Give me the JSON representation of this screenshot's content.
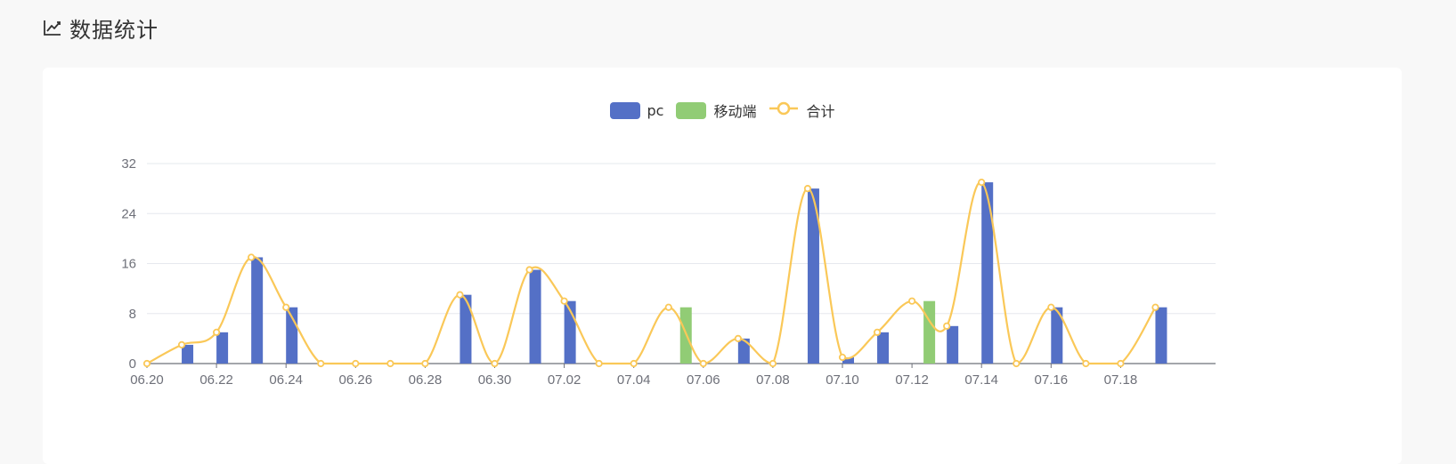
{
  "page": {
    "title": "数据统计",
    "title_icon": "line-chart-icon"
  },
  "colors": {
    "pc": "#5470c6",
    "mobile": "#91cc75",
    "total": "#fac858"
  },
  "chart_data": {
    "type": "bar",
    "categories": [
      "06.20",
      "06.21",
      "06.22",
      "06.23",
      "06.24",
      "06.25",
      "06.26",
      "06.27",
      "06.28",
      "06.29",
      "06.30",
      "07.01",
      "07.02",
      "07.03",
      "07.04",
      "07.05",
      "07.06",
      "07.07",
      "07.08",
      "07.09",
      "07.10",
      "07.11",
      "07.12",
      "07.13",
      "07.14",
      "07.15",
      "07.16",
      "07.17",
      "07.18",
      "07.19"
    ],
    "x_tick_labels": [
      "06.20",
      "06.22",
      "06.24",
      "06.26",
      "06.28",
      "06.30",
      "07.02",
      "07.04",
      "07.06",
      "07.08",
      "07.10",
      "07.12",
      "07.14",
      "07.16",
      "07.18"
    ],
    "y_tick_labels": [
      "0",
      "8",
      "16",
      "24",
      "32"
    ],
    "ylim": [
      0,
      32
    ],
    "grid": true,
    "legend_position": "top-center",
    "series": [
      {
        "name": "pc",
        "type": "bar",
        "color": "#5470c6",
        "values": [
          0,
          3,
          5,
          17,
          9,
          0,
          0,
          0,
          0,
          11,
          0,
          15,
          10,
          0,
          0,
          0,
          0,
          4,
          0,
          28,
          1,
          5,
          0,
          6,
          29,
          0,
          9,
          0,
          0,
          9
        ]
      },
      {
        "name": "移动端",
        "type": "bar",
        "color": "#91cc75",
        "values": [
          0,
          0,
          0,
          0,
          0,
          0,
          0,
          0,
          0,
          0,
          0,
          0,
          0,
          0,
          0,
          9,
          0,
          0,
          0,
          0,
          0,
          0,
          10,
          0,
          0,
          0,
          0,
          0,
          0,
          0
        ]
      },
      {
        "name": "合计",
        "type": "line",
        "smooth": true,
        "color": "#fac858",
        "values": [
          0,
          3,
          5,
          17,
          9,
          0,
          0,
          0,
          0,
          11,
          0,
          15,
          10,
          0,
          0,
          9,
          0,
          4,
          0,
          28,
          1,
          5,
          10,
          6,
          29,
          0,
          9,
          0,
          0,
          9
        ]
      }
    ]
  }
}
